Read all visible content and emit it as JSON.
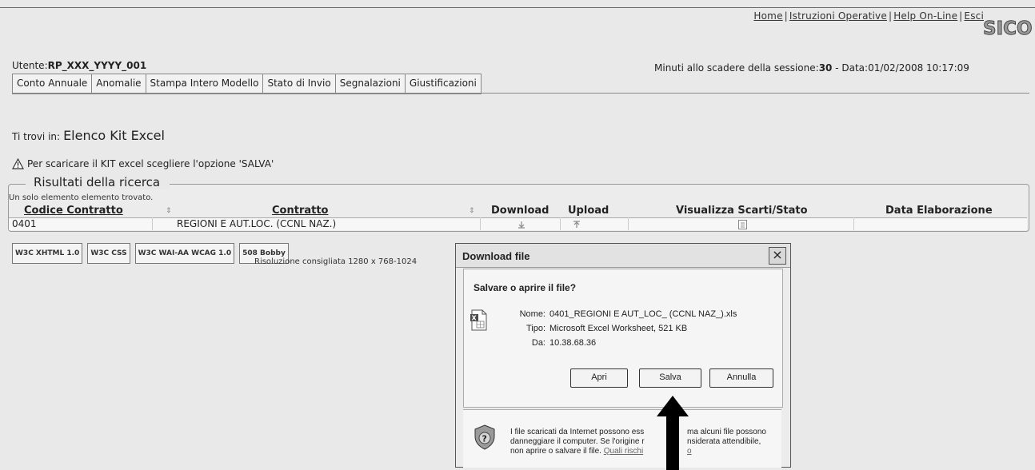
{
  "header": {
    "links": [
      "Home",
      "Istruzioni Operative",
      "Help On-Line",
      "Esci"
    ],
    "logo_text": "SICO",
    "user_label": "Utente:",
    "user_value": "RP_XXX_YYYY_001",
    "session_label": "Minuti allo scadere della sessione:",
    "session_minutes": "30",
    "date_label": "- Data:",
    "date_value": "01/02/2008 10:17:09"
  },
  "nav": {
    "items": [
      "Conto Annuale",
      "Anomalie",
      "Stampa Intero Modello",
      "Stato di Invio",
      "Segnalazioni",
      "Giustificazioni"
    ]
  },
  "breadcrumb": {
    "prefix": "Ti trovi in:",
    "page": "Elenco Kit Excel"
  },
  "notice": "Per scaricare il KIT excel scegliere l'opzione 'SALVA'",
  "results": {
    "legend": "Risultati della ricerca",
    "found_text": "Un solo elemento elemento trovato.",
    "columns": [
      "Codice Contratto",
      "Contratto",
      "Download",
      "Upload",
      "Visualizza Scarti/Stato",
      "Data Elaborazione"
    ],
    "rows": [
      {
        "codice": "0401",
        "contratto": "REGIONI E AUT.LOC. (CCNL NAZ.)",
        "data": ""
      }
    ]
  },
  "footer": {
    "badges": [
      "W3C XHTML 1.0",
      "W3C CSS",
      "W3C WAI-AA WCAG 1.0",
      "508 Bobby"
    ],
    "resolution": "Risoluzione consigliata 1280 x 768-1024"
  },
  "dialog": {
    "title": "Download file",
    "question": "Salvare o aprire il file?",
    "name_label": "Nome:",
    "name_value": "0401_REGIONI E AUT_LOC_ (CCNL NAZ_).xls",
    "type_label": "Tipo:",
    "type_value": "Microsoft Excel Worksheet, 521 KB",
    "from_label": "Da:",
    "from_value": "10.38.68.36",
    "buttons": {
      "open": "Apri",
      "save": "Salva",
      "cancel": "Annulla"
    },
    "warning_col1": [
      "I file scaricati da Internet possono ess",
      "danneggiare il computer. Se l'origine r",
      "non aprire o salvare il file."
    ],
    "warning_link": "Quali rischi",
    "warning_col2": [
      "ma alcuni file possono",
      "nsiderata attendibile,",
      "o"
    ]
  }
}
